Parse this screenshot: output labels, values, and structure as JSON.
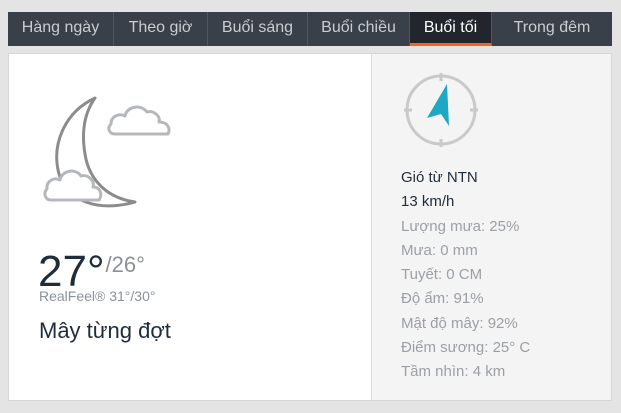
{
  "tabs": [
    {
      "label": "Hàng ngày",
      "active": false
    },
    {
      "label": "Theo giờ",
      "active": false
    },
    {
      "label": "Buổi sáng",
      "active": false
    },
    {
      "label": "Buổi chiều",
      "active": false
    },
    {
      "label": "Buổi tối",
      "active": true
    },
    {
      "label": "Trong đêm",
      "active": false
    }
  ],
  "forecast": {
    "icon": "moon-cloud-icon",
    "temp": "27°",
    "low_temp": "/26°",
    "realfeel": "RealFeel® 31°/30°",
    "phrase": "Mây từng đợt"
  },
  "wind": {
    "icon": "compass-icon",
    "direction": "Gió từ NTN",
    "speed": "13 km/h"
  },
  "details": [
    "Lượng mưa: 25%",
    "Mưa: 0 mm",
    "Tuyết: 0 CM",
    "Độ ẩm: 91%",
    "Mật độ mây: 92%",
    "Điểm sương: 25° C",
    "Tầm nhìn: 4 km"
  ],
  "colors": {
    "accent": "#f26522",
    "tab_bar": "#394049",
    "compass_arrow": "#1da8c4"
  }
}
